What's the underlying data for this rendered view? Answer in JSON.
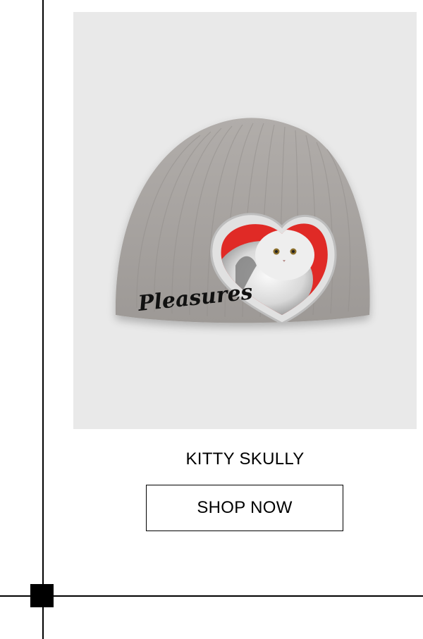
{
  "product": {
    "title": "KITTY SKULLY",
    "image_alt": "Grey knit beanie with a heart-framed Persian cat patch and Pleasures gothic embroidery",
    "brand_embroidery": "Pleasures"
  },
  "cta": {
    "shop_label": "SHOP NOW"
  },
  "colors": {
    "image_background": "#e9e9e9",
    "beanie": "#a7a3a0",
    "heart": "#e02a26",
    "frame": "#dcdcdc",
    "lines": "#000000"
  },
  "icons": {
    "corner": "square-marker-icon"
  }
}
